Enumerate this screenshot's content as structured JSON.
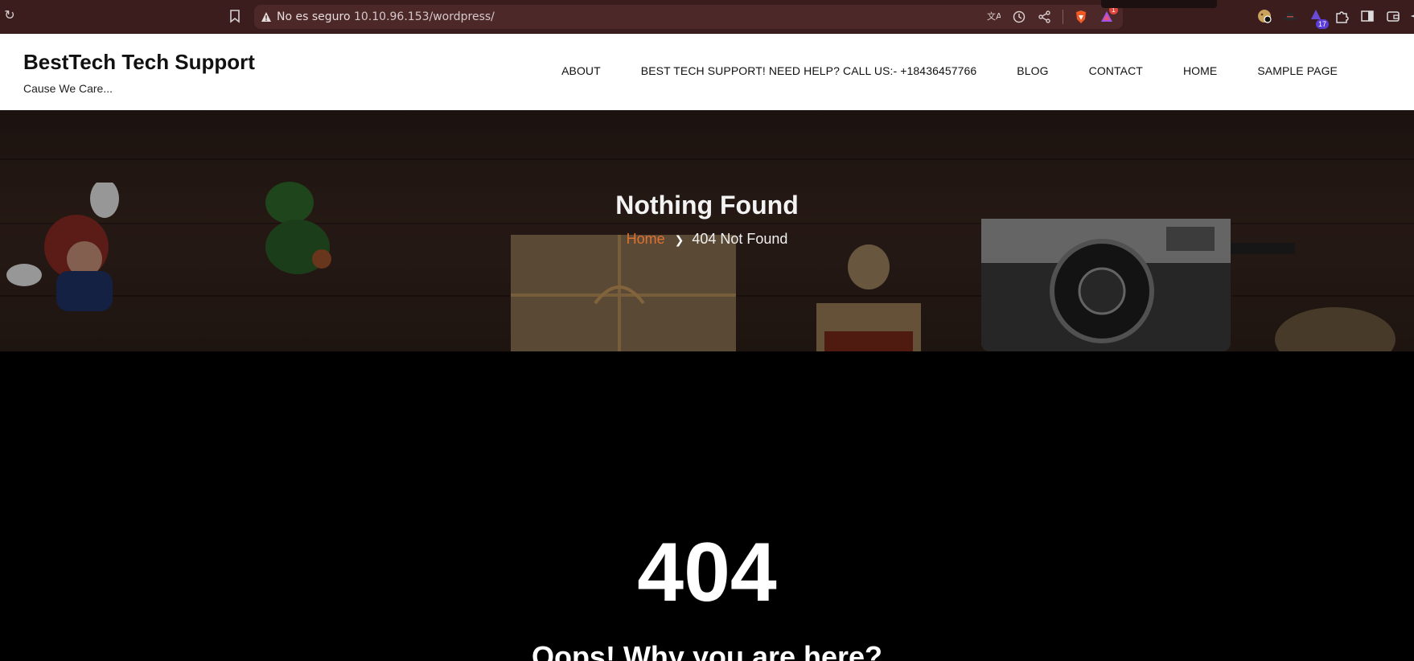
{
  "browser": {
    "security_label": "No es seguro",
    "url": "10.10.96.153/wordpress/",
    "alert_badge": "1",
    "extension_badge": "17"
  },
  "site": {
    "title": "BestTech Tech Support",
    "tagline": "Cause We Care..."
  },
  "nav": {
    "items": [
      {
        "label": "ABOUT"
      },
      {
        "label": "BEST TECH SUPPORT! NEED HELP? CALL US:- +18436457766"
      },
      {
        "label": "BLOG"
      },
      {
        "label": "CONTACT"
      },
      {
        "label": "HOME"
      },
      {
        "label": "SAMPLE PAGE"
      }
    ]
  },
  "hero": {
    "title": "Nothing Found",
    "breadcrumb_home": "Home",
    "breadcrumb_current": "404 Not Found"
  },
  "main": {
    "error_code": "404",
    "message": "Oops! Why you are here?"
  }
}
